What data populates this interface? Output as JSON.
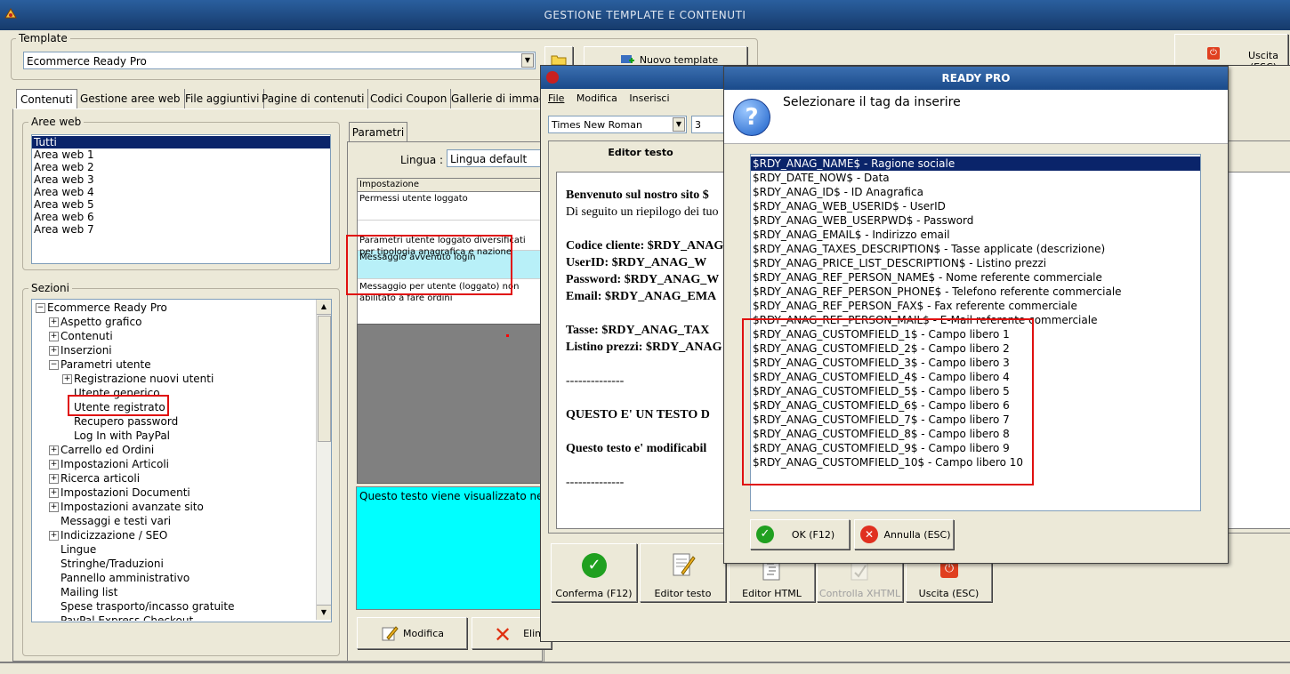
{
  "main_window": {
    "title": "GESTIONE TEMPLATE E CONTENUTI",
    "template_label": "Template",
    "template_value": "Ecommerce Ready Pro",
    "new_template_button": "Nuovo template",
    "exit_button": "Uscita (ESC)",
    "tabs": [
      "Contenuti",
      "Gestione aree web",
      "File aggiuntivi",
      "Pagine di contenuti",
      "Codici Coupon",
      "Gallerie di immagin"
    ],
    "aree_web_label": "Aree web",
    "aree_web": [
      "Tutti",
      "Area web 1",
      "Area web 2",
      "Area web 3",
      "Area web 4",
      "Area web 5",
      "Area web 6",
      "Area web 7"
    ],
    "sezioni_label": "Sezioni",
    "tree": [
      {
        "label": "Ecommerce Ready Pro",
        "level": 0,
        "expander": "minus"
      },
      {
        "label": "Aspetto grafico",
        "level": 1,
        "expander": "plus"
      },
      {
        "label": "Contenuti",
        "level": 1,
        "expander": "plus"
      },
      {
        "label": "Inserzioni",
        "level": 1,
        "expander": "plus"
      },
      {
        "label": "Parametri utente",
        "level": 1,
        "expander": "minus"
      },
      {
        "label": "Registrazione nuovi utenti",
        "level": 2,
        "expander": "plus"
      },
      {
        "label": "Utente generico",
        "level": 2,
        "expander": ""
      },
      {
        "label": "Utente registrato",
        "level": 2,
        "expander": ""
      },
      {
        "label": "Recupero password",
        "level": 2,
        "expander": ""
      },
      {
        "label": "Log In with PayPal",
        "level": 2,
        "expander": ""
      },
      {
        "label": "Carrello ed Ordini",
        "level": 1,
        "expander": "plus"
      },
      {
        "label": "Impostazioni Articoli",
        "level": 1,
        "expander": "plus"
      },
      {
        "label": "Ricerca articoli",
        "level": 1,
        "expander": "plus"
      },
      {
        "label": "Impostazioni Documenti",
        "level": 1,
        "expander": "plus"
      },
      {
        "label": "Impostazioni avanzate sito",
        "level": 1,
        "expander": "plus"
      },
      {
        "label": "Messaggi e testi vari",
        "level": 1,
        "expander": ""
      },
      {
        "label": "Indicizzazione / SEO",
        "level": 1,
        "expander": "plus"
      },
      {
        "label": "Lingue",
        "level": 1,
        "expander": ""
      },
      {
        "label": "Stringhe/Traduzioni",
        "level": 1,
        "expander": ""
      },
      {
        "label": "Pannello amministrativo",
        "level": 1,
        "expander": ""
      },
      {
        "label": "Mailing list",
        "level": 1,
        "expander": ""
      },
      {
        "label": "Spese trasporto/incasso gratuite",
        "level": 1,
        "expander": ""
      },
      {
        "label": "PayPal Express Checkout",
        "level": 1,
        "expander": ""
      }
    ],
    "parametri_tab": "Parametri",
    "lingua_label": "Lingua :",
    "lingua_value": "Lingua default",
    "grid_header": "Impostazione",
    "grid_rows": [
      "Permessi utente loggato",
      "Parametri utente loggato diversificati per tipologia anagrafica e nazione",
      "Messaggio avvenuto login",
      "Messaggio per utente (loggato) non abilitato a fare ordini"
    ],
    "description_text": "Questo testo viene visualizzato nella s",
    "modifica_button": "Modifica",
    "elimina_button": "Elim"
  },
  "editor_window": {
    "menu": [
      "File",
      "Modifica",
      "Inserisci"
    ],
    "font_name": "Times New Roman",
    "font_size": "3",
    "editor_tab": "Editor testo",
    "content_lines": [
      {
        "text": "Benvenuto sul nostro sito $",
        "bold": true
      },
      {
        "text": "Di seguito un riepilogo dei tuo",
        "bold": false
      },
      {
        "text": "",
        "bold": false
      },
      {
        "text": "Codice cliente: $RDY_ANAG",
        "bold": true
      },
      {
        "text": "UserID: $RDY_ANAG_W",
        "bold": true
      },
      {
        "text": "Password: $RDY_ANAG_W",
        "bold": true
      },
      {
        "text": "Email: $RDY_ANAG_EMA",
        "bold": true
      },
      {
        "text": "",
        "bold": false
      },
      {
        "text": "Tasse: $RDY_ANAG_TAX",
        "bold": true
      },
      {
        "text": "Listino prezzi: $RDY_ANAG",
        "bold": true
      },
      {
        "text": "",
        "bold": false
      },
      {
        "text": "--------------",
        "bold": false
      },
      {
        "text": "",
        "bold": false
      },
      {
        "text": "QUESTO E' UN TESTO D",
        "bold": true
      },
      {
        "text": "",
        "bold": false
      },
      {
        "text": "Questo testo e' modificabil",
        "bold": true
      },
      {
        "text": "",
        "bold": false
      },
      {
        "text": "--------------",
        "bold": false
      }
    ],
    "buttons": [
      "Conferma (F12)",
      "Editor testo",
      "Editor HTML",
      "Controlla XHTML",
      "Uscita (ESC)"
    ]
  },
  "dialog": {
    "title": "READY PRO",
    "question": "Selezionare il tag da inserire",
    "tags": [
      "$RDY_ANAG_NAME$ - Ragione sociale",
      "$RDY_DATE_NOW$ - Data",
      "$RDY_ANAG_ID$ - ID Anagrafica",
      "$RDY_ANAG_WEB_USERID$ - UserID",
      "$RDY_ANAG_WEB_USERPWD$ - Password",
      "$RDY_ANAG_EMAIL$ - Indirizzo email",
      "$RDY_ANAG_TAXES_DESCRIPTION$ - Tasse applicate (descrizione)",
      "$RDY_ANAG_PRICE_LIST_DESCRIPTION$ - Listino prezzi",
      "$RDY_ANAG_REF_PERSON_NAME$ - Nome referente commerciale",
      "$RDY_ANAG_REF_PERSON_PHONE$ - Telefono referente commerciale",
      "$RDY_ANAG_REF_PERSON_FAX$ - Fax referente commerciale",
      "$RDY_ANAG_REF_PERSON_MAIL$ - E-Mail referente commerciale",
      "$RDY_ANAG_CUSTOMFIELD_1$ - Campo libero 1",
      "$RDY_ANAG_CUSTOMFIELD_2$ - Campo libero 2",
      "$RDY_ANAG_CUSTOMFIELD_3$ - Campo libero 3",
      "$RDY_ANAG_CUSTOMFIELD_4$ - Campo libero 4",
      "$RDY_ANAG_CUSTOMFIELD_5$ - Campo libero 5",
      "$RDY_ANAG_CUSTOMFIELD_6$ - Campo libero 6",
      "$RDY_ANAG_CUSTOMFIELD_7$ - Campo libero 7",
      "$RDY_ANAG_CUSTOMFIELD_8$ - Campo libero 8",
      "$RDY_ANAG_CUSTOMFIELD_9$ - Campo libero 9",
      "$RDY_ANAG_CUSTOMFIELD_10$ - Campo libero 10"
    ],
    "ok_button": "OK (F12)",
    "cancel_button": "Annulla (ESC)"
  },
  "colors": {
    "highlight": "#e01010",
    "selection": "#0a246a",
    "cyan_panel": "#00ffff",
    "light_cyan_row": "#b8f0f8"
  }
}
